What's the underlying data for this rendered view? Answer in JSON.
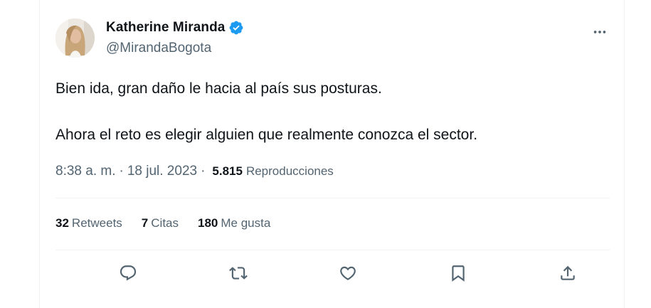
{
  "tweet": {
    "author_name": "Katherine Miranda",
    "handle": "@MirandaBogota",
    "paragraphs": [
      "Bien ida, gran daño le hacia al país sus posturas.",
      "Ahora el reto es elegir alguien que realmente conozca el sector."
    ],
    "time": "8:38 a. m.",
    "separator": "·",
    "date": "18 jul. 2023",
    "views_count": "5.815",
    "views_label": "Reproducciones"
  },
  "stats": {
    "retweets_count": "32",
    "retweets_label": "Retweets",
    "quotes_count": "7",
    "quotes_label": "Citas",
    "likes_count": "180",
    "likes_label": "Me gusta"
  },
  "icons": {
    "verified": "verified-badge-icon",
    "more": "more-horizontal-icon",
    "reply": "reply-icon",
    "retweet": "retweet-icon",
    "like": "heart-icon",
    "bookmark": "bookmark-icon",
    "share": "share-icon"
  },
  "colors": {
    "text_primary": "#0f1419",
    "text_secondary": "#536471",
    "verified_blue": "#1d9bf0",
    "divider": "#eff3f4"
  }
}
